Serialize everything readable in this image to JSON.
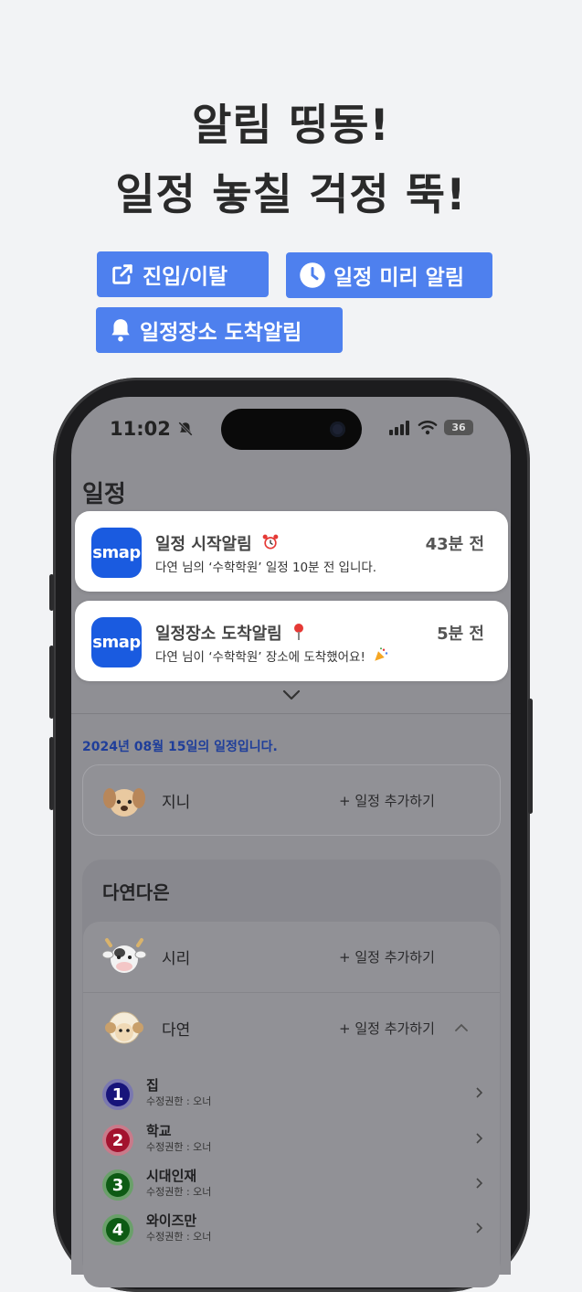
{
  "headline": {
    "line1": "알림 띵동!",
    "line2": "일정 놓칠 걱정 뚝!"
  },
  "badges": [
    {
      "label": "진입/이탈",
      "icon": "external-link-icon"
    },
    {
      "label": "일정 미리 알림",
      "icon": "clock-icon"
    },
    {
      "label": "일정장소 도착알림",
      "icon": "bell-icon"
    }
  ],
  "colors": {
    "accent": "#4e80ee",
    "app_icon": "#1a5be0",
    "headline": "#2a2a2a"
  },
  "status_bar": {
    "time": "11:02",
    "battery": "36"
  },
  "app": {
    "page_title": "일정",
    "icon_label": "smap"
  },
  "notifications": [
    {
      "title": "일정 시작알림",
      "emoji": "alarm-clock",
      "body": "다연 님의 ‘수학학원’ 일정 10분 전 입니다.",
      "time": "43분 전"
    },
    {
      "title": "일정장소 도착알림",
      "emoji": "pin",
      "body": "다연 님이 ‘수학학원’ 장소에 도착했어요!",
      "time": "5분 전"
    }
  ],
  "date_note": "2024년 08월 15일의 일정입니다.",
  "self_member": {
    "name": "지니",
    "add": "+ 일정 추가하기"
  },
  "group": {
    "title": "다연다은",
    "members": [
      {
        "name": "시리",
        "add": "+ 일정 추가하기"
      },
      {
        "name": "다연",
        "add": "+ 일정 추가하기"
      }
    ]
  },
  "places": [
    {
      "num": "1",
      "name": "집",
      "sub": "수정권한 : 오너"
    },
    {
      "num": "2",
      "name": "학교",
      "sub": "수정권한 : 오너"
    },
    {
      "num": "3",
      "name": "시대인재",
      "sub": "수정권한 : 오너"
    },
    {
      "num": "4",
      "name": "와이즈만",
      "sub": "수정권한 : 오너"
    }
  ]
}
